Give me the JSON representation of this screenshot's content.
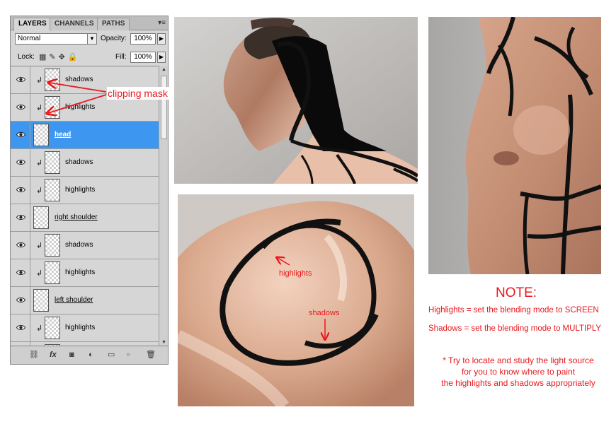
{
  "panel": {
    "tabs": [
      "LAYERS",
      "CHANNELS",
      "PATHS"
    ],
    "blend_mode": "Normal",
    "opacity_label": "Opacity:",
    "opacity_value": "100%",
    "lock_label": "Lock:",
    "fill_label": "Fill:",
    "fill_value": "100%",
    "layers": [
      {
        "name": "shadows",
        "clipped": true,
        "group": false,
        "selected": false
      },
      {
        "name": "highlights",
        "clipped": true,
        "group": false,
        "selected": false
      },
      {
        "name": "head",
        "clipped": false,
        "group": true,
        "selected": true
      },
      {
        "name": "shadows",
        "clipped": true,
        "group": false,
        "selected": false
      },
      {
        "name": "highlights",
        "clipped": true,
        "group": false,
        "selected": false
      },
      {
        "name": "right shoulder",
        "clipped": false,
        "group": true,
        "selected": false
      },
      {
        "name": "shadows",
        "clipped": true,
        "group": false,
        "selected": false
      },
      {
        "name": "highlights",
        "clipped": true,
        "group": false,
        "selected": false
      },
      {
        "name": "left shoulder",
        "clipped": false,
        "group": true,
        "selected": false
      },
      {
        "name": "highlights",
        "clipped": true,
        "group": false,
        "selected": false
      },
      {
        "name": "",
        "clipped": true,
        "group": false,
        "selected": false
      }
    ]
  },
  "annotations": {
    "clipping_mask": "clipping mask",
    "highlights": "highlights",
    "shadows": "shadows"
  },
  "note": {
    "title": "NOTE:",
    "line1": "Highlights  = set the blending mode to SCREEN",
    "line2": "Shadows   = set the blending mode to MULTIPLY",
    "tip1": "* Try to locate and study  the light source",
    "tip2": "for you to know where to paint",
    "tip3": "the highlights and shadows appropriately"
  },
  "colors": {
    "accent_red": "#e8191e",
    "selection_blue": "#3d97f0",
    "panel_gray": "#d6d6d6",
    "skin": "#d9a88c"
  }
}
